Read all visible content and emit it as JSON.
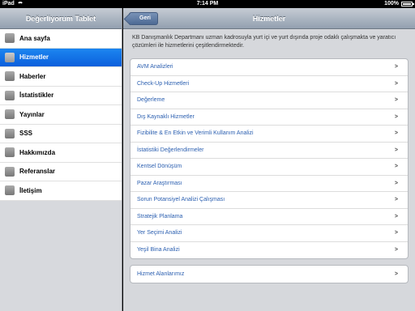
{
  "status": {
    "carrier": "iPad",
    "time": "7:14 PM",
    "battery": "100%"
  },
  "sidebar": {
    "title": "Değerliyorum Tablet",
    "items": [
      {
        "label": "Ana sayfa",
        "active": false
      },
      {
        "label": "Hizmetler",
        "active": true
      },
      {
        "label": "Haberler",
        "active": false
      },
      {
        "label": "İstatistikler",
        "active": false
      },
      {
        "label": "Yayınlar",
        "active": false
      },
      {
        "label": "SSS",
        "active": false
      },
      {
        "label": "Hakkımızda",
        "active": false
      },
      {
        "label": "Referanslar",
        "active": false
      },
      {
        "label": "İletişim",
        "active": false
      }
    ]
  },
  "main": {
    "back_label": "Geri",
    "title": "Hizmetler",
    "intro": "KB Danışmanlık Departmanı uzman kadrosuyla yurt içi ve yurt dışında proje odaklı çalışmakta ve yaratıcı çözümleri ile hizmetlerini çeşitlendirmektedir.",
    "arrow": ">",
    "services": [
      "AVM Analizleri",
      "Check-Up Hizmetleri",
      "Değerleme",
      "Dış Kaynaklı Hizmetler",
      "Fizibilite & En Etkin ve Verimli Kullanım Analizi",
      "İstatistiki Değerlendirmeler",
      "Kentsel Dönüşüm",
      "Pazar Araştırması",
      "Sorun Potansiyel Analizi Çalışması",
      "Stratejik Planlama",
      "Yer Seçimi Analizi",
      "Yeşil Bina Analizi"
    ],
    "areas": [
      "Hizmet Alanlarımız"
    ]
  }
}
